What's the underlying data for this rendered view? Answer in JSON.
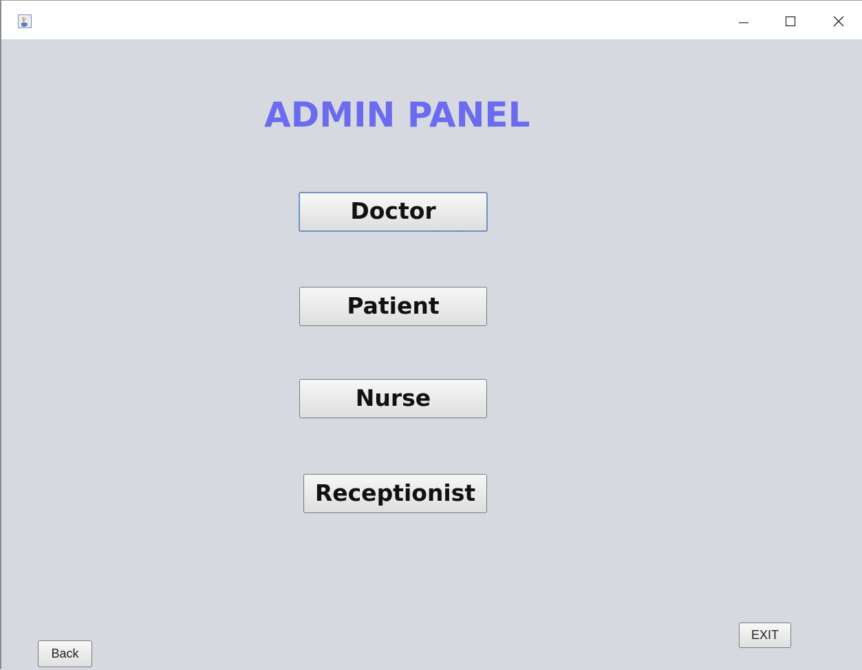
{
  "window": {
    "app_icon": "java-cup-icon",
    "controls": {
      "minimize_icon": "minimize-icon",
      "maximize_icon": "maximize-icon",
      "close_icon": "close-icon"
    }
  },
  "panel": {
    "title": "ADMIN PANEL",
    "title_color": "#6b6bf0",
    "background_color": "#d6d9e0",
    "buttons": [
      {
        "label": "Doctor",
        "focused": true
      },
      {
        "label": "Patient",
        "focused": false
      },
      {
        "label": "Nurse",
        "focused": false
      },
      {
        "label": "Receptionist",
        "focused": false
      }
    ]
  },
  "footer": {
    "exit_label": "EXIT",
    "back_label": "Back"
  }
}
